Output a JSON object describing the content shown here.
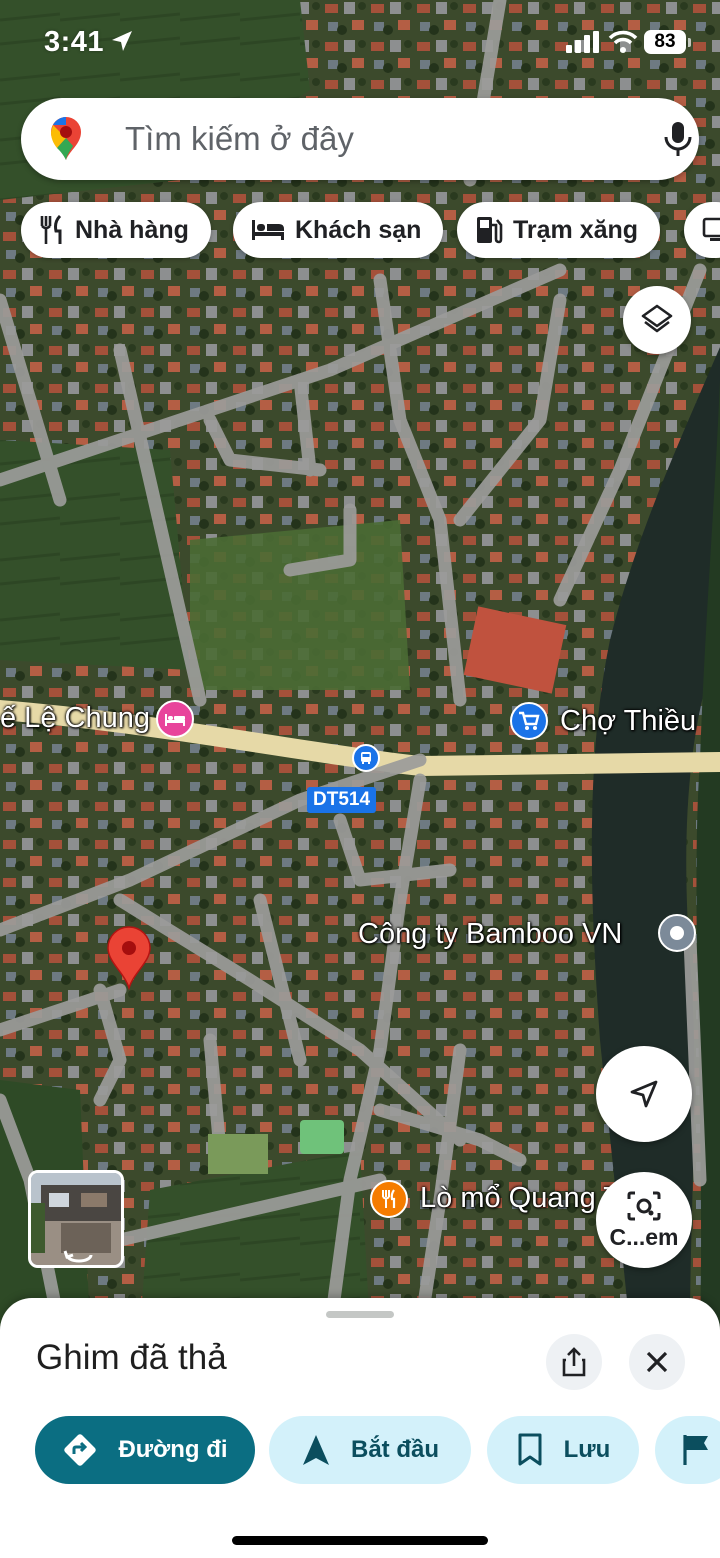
{
  "status_bar": {
    "time": "3:41",
    "battery": "83"
  },
  "search": {
    "placeholder": "Tìm kiếm ở đây"
  },
  "chips": [
    {
      "label": "Nhà hàng",
      "icon": "restaurant-icon"
    },
    {
      "label": "Khách sạn",
      "icon": "hotel-icon"
    },
    {
      "label": "Trạm xăng",
      "icon": "gas-station-icon"
    }
  ],
  "map": {
    "labels": {
      "le_chung": "ế Lệ Chung",
      "cho_thieu": "Chợ Thiều",
      "bamboo": "Công ty Bamboo VN",
      "lo_mo": "Lò mổ Quang Trung",
      "road": "DT514"
    },
    "pin_color": "#ea4335",
    "hotel_color": "#e8449b",
    "shopping_color": "#1a73e8",
    "food_color": "#f57c00"
  },
  "controls": {
    "camera_label": "C...em"
  },
  "sheet": {
    "title": "Ghim đã thả",
    "actions": [
      {
        "label": "Đường đi"
      },
      {
        "label": "Bắt đầu"
      },
      {
        "label": "Lưu"
      }
    ],
    "primary_color": "#0b6e82",
    "secondary_color": "#d3f1fa"
  }
}
